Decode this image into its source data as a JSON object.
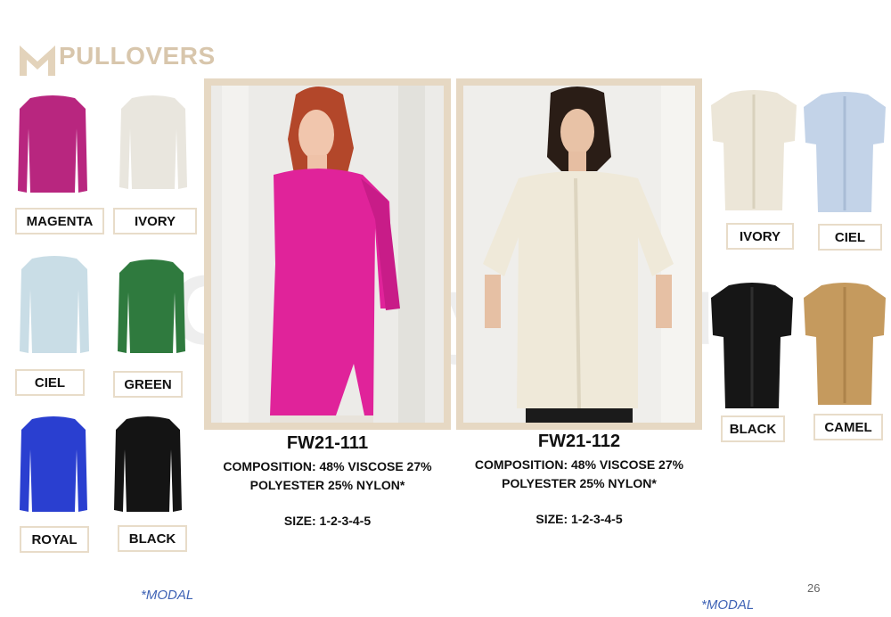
{
  "header": {
    "title": "PULLOVERS",
    "logo": "m-logo-icon",
    "brand_color": "#d8c6ac"
  },
  "left_swatches": [
    {
      "label": "MAGENTA",
      "color": "#b8267f"
    },
    {
      "label": "IVORY",
      "color": "#e9e6de"
    },
    {
      "label": "CIEL",
      "color": "#c9dde6"
    },
    {
      "label": "GREEN",
      "color": "#2f7a3e"
    },
    {
      "label": "ROYAL",
      "color": "#2a3fd0"
    },
    {
      "label": "BLACK",
      "color": "#141414"
    }
  ],
  "right_swatches": [
    {
      "label": "IVORY",
      "color": "#ece6d8"
    },
    {
      "label": "CIEL",
      "color": "#c3d3e8"
    },
    {
      "label": "BLACK",
      "color": "#161616"
    },
    {
      "label": "CAMEL",
      "color": "#c59a5e"
    }
  ],
  "products": [
    {
      "model": "FW21-111",
      "composition_line1": "COMPOSITION: 48% VISCOSE 27%",
      "composition_line2": "POLYESTER 25% NYLON*",
      "size": "SIZE: 1-2-3-4-5",
      "garment_color": "#e0239a"
    },
    {
      "model": "FW21-112",
      "composition_line1": "COMPOSITION: 48% VISCOSE 27%",
      "composition_line2": "POLYESTER 25% NYLON*",
      "size": "SIZE: 1-2-3-4-5",
      "garment_color": "#efe9d9"
    }
  ],
  "footer": {
    "modal_left": "*MODAL",
    "modal_right": "*MODAL",
    "page_number": "26"
  },
  "watermark": "OptStyle.ru"
}
